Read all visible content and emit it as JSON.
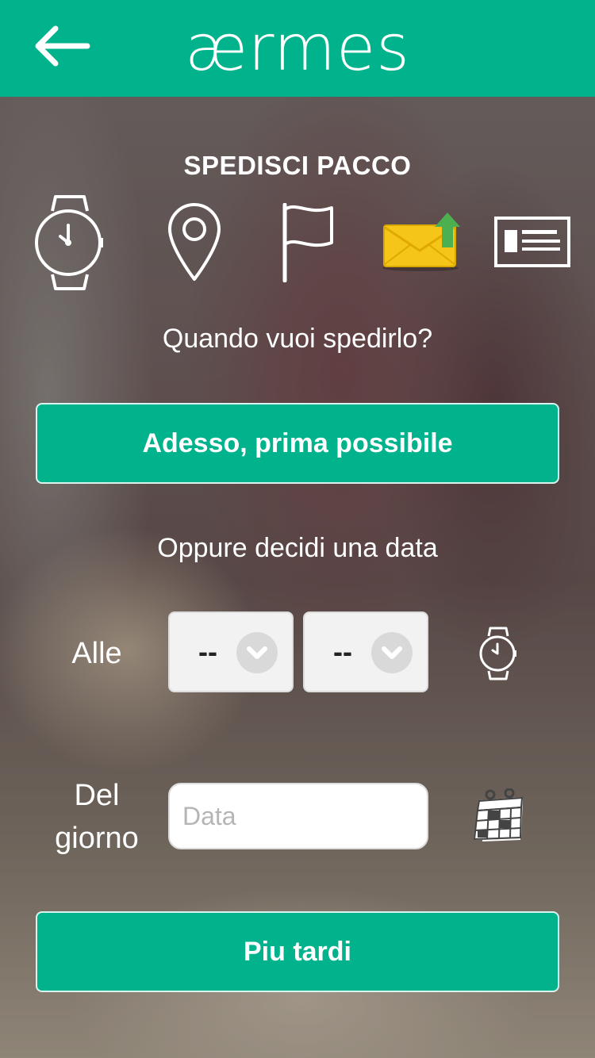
{
  "header": {
    "logo_text": "ærmes",
    "back_icon": "arrow-left-icon"
  },
  "page": {
    "title": "SPEDISCI PACCO",
    "steps": [
      {
        "icon": "watch-icon",
        "state": "active"
      },
      {
        "icon": "location-pin-icon",
        "state": "inactive"
      },
      {
        "icon": "flag-icon",
        "state": "inactive"
      },
      {
        "icon": "envelope-upload-icon",
        "state": "inactive"
      },
      {
        "icon": "id-card-icon",
        "state": "inactive"
      }
    ],
    "question": "Quando vuoi spedirlo?",
    "now_button": "Adesso, prima possibile",
    "or_text": "Oppure decidi una data",
    "time_label": "Alle",
    "hour_value": "--",
    "minute_value": "--",
    "date_label_line1": "Del",
    "date_label_line2": "giorno",
    "date_placeholder": "Data",
    "later_button": "Piu tardi"
  },
  "colors": {
    "accent": "#00b38c",
    "text": "#ffffff",
    "envelope": "#f5c518",
    "upload_arrow": "#4caf50"
  }
}
